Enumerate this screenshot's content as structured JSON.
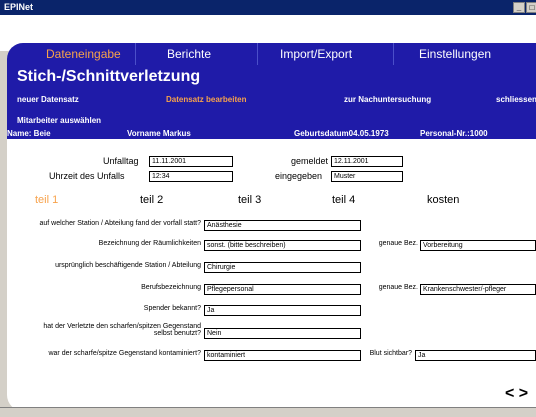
{
  "window": {
    "title": "EPINet",
    "min": "_",
    "max": "□"
  },
  "nav": {
    "items": [
      "Dateneingabe",
      "Berichte",
      "Import/Export",
      "Einstellungen"
    ]
  },
  "header": {
    "title": "Stich-/Schnittverletzung",
    "actions": [
      "neuer Datensatz",
      "Datensatz bearbeiten",
      "zur Nachuntersuchung",
      "schliessen"
    ],
    "mitarbeiter": "Mitarbeiter auswählen"
  },
  "person": {
    "name": "Name: Beie",
    "vorname": "Vorname  Markus",
    "geburtsdatum": "Geburtsdatum04.05.1973",
    "personal_nr": "Personal-Nr.:1000"
  },
  "meta": {
    "unfalltag_label": "Unfalltag",
    "unfalltag_value": "11.11.2001",
    "uhrzeit_label": "Uhrzeit des Unfalls",
    "uhrzeit_value": "12:34",
    "gemeldet_label": "gemeldet",
    "gemeldet_value": "12.11.2001",
    "eingegeben_label": "eingegeben",
    "eingegeben_value": "Muster"
  },
  "tabs": [
    "teil 1",
    "teil 2",
    "teil 3",
    "teil 4",
    "kosten"
  ],
  "form": {
    "station_label": "auf welcher Station / Abteilung fand der vorfall statt?",
    "station_value": "Anästhesie",
    "raum_label": "Bezeichnung der Räumlichkeiten",
    "raum_value": "sonst. (bitte beschreiben)",
    "raum_bez_label": "genaue Bez.",
    "raum_bez_value": "Vorbereitung",
    "urspr_label": "ursprünglich beschäftigende Station / Abteilung",
    "urspr_value": "Chirurgie",
    "beruf_label": "Berufsbezeichnung",
    "beruf_value": "Pflegepersonal",
    "beruf_bez_label": "genaue Bez.",
    "beruf_bez_value": "Krankenschwester/-pfleger",
    "spender_label": "Spender bekannt?",
    "spender_value": "Ja",
    "benutzt_label_1": "hat der Verletzte den scharfen/spitzen Gegenstand",
    "benutzt_label_2": "selbst benutzt?",
    "benutzt_value": "Nein",
    "kontam_label": "war der scharfe/spitze Gegenstand kontaminiert?",
    "kontam_value": "kontaminiert",
    "blut_label": "Blut sichtbar?",
    "blut_value": "Ja"
  },
  "pager": {
    "prev": "<",
    "next": ">"
  }
}
